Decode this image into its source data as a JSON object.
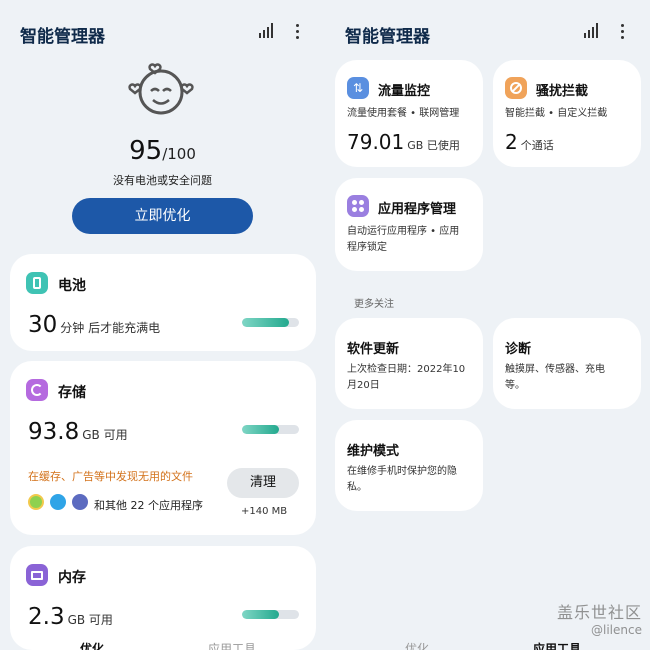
{
  "left": {
    "app_title": "智能管理器",
    "score": {
      "value": "95",
      "max": "/100"
    },
    "status_text": "没有电池或安全问题",
    "optimize_button": "立即优化",
    "battery": {
      "title": "电池",
      "value": "30",
      "unit_text": "分钟 后才能充满电",
      "progress": 0.82
    },
    "storage": {
      "title": "存储",
      "value": "93.8",
      "unit_text": "GB 可用",
      "progress": 0.65,
      "cache_notice": "在缓存、广告等中发现无用的文件",
      "other_apps": "和其他 22 个应用程序",
      "clean_button": "清理",
      "reclaim_size": "+140 MB"
    },
    "memory": {
      "title": "内存",
      "value": "2.3",
      "unit_text": "GB 可用",
      "progress": 0.65
    },
    "bottom_tabs": [
      "优化",
      "应用工具"
    ]
  },
  "right": {
    "app_title": "智能管理器",
    "data_monitor": {
      "title": "流量监控",
      "subtitle": "流量使用套餐 • 联网管理",
      "value": "79.01",
      "unit_text": "GB 已使用"
    },
    "block_calls": {
      "title": "骚扰拦截",
      "subtitle": "智能拦截 • 自定义拦截",
      "value": "2",
      "unit_text": "个通话"
    },
    "app_manager": {
      "title": "应用程序管理",
      "subtitle_line1": "自动运行应用程序 • 应用",
      "subtitle_line2": "程序锁定"
    },
    "section_label": "更多关注",
    "software_update": {
      "title": "软件更新",
      "subtitle_line1": "上次检查日期：2022年10",
      "subtitle_line2": "月20日"
    },
    "diagnostics": {
      "title": "诊断",
      "subtitle_line1": "触摸屏、传感器、充电",
      "subtitle_line2": "等。"
    },
    "maintenance": {
      "title": "维护模式",
      "subtitle_line1": "在维修手机时保护您的隐",
      "subtitle_line2": "私。"
    },
    "bottom_tabs": [
      "优化",
      "应用工具"
    ]
  },
  "watermark": {
    "line1": "盖乐世社区",
    "line2": "@lilence"
  },
  "icons": {
    "signal": "signal-bars-icon",
    "more": "more-vertical-icon",
    "face": "happy-face-icon",
    "battery": "battery-icon",
    "storage": "storage-pie-icon",
    "memory": "memory-chip-icon",
    "data": "data-transfer-icon",
    "block": "block-icon",
    "apps": "apps-grid-icon"
  },
  "colors": {
    "accent": "#1d58a8",
    "progress": "#23a98e",
    "warning": "#d3731c",
    "battery_icon": "#3fc3b4",
    "storage_icon": "#b56adf",
    "memory_icon": "#8a63d6",
    "data_icon": "#5a8fe0",
    "block_icon": "#f0a35a",
    "apps_icon": "#9a7fe0"
  }
}
